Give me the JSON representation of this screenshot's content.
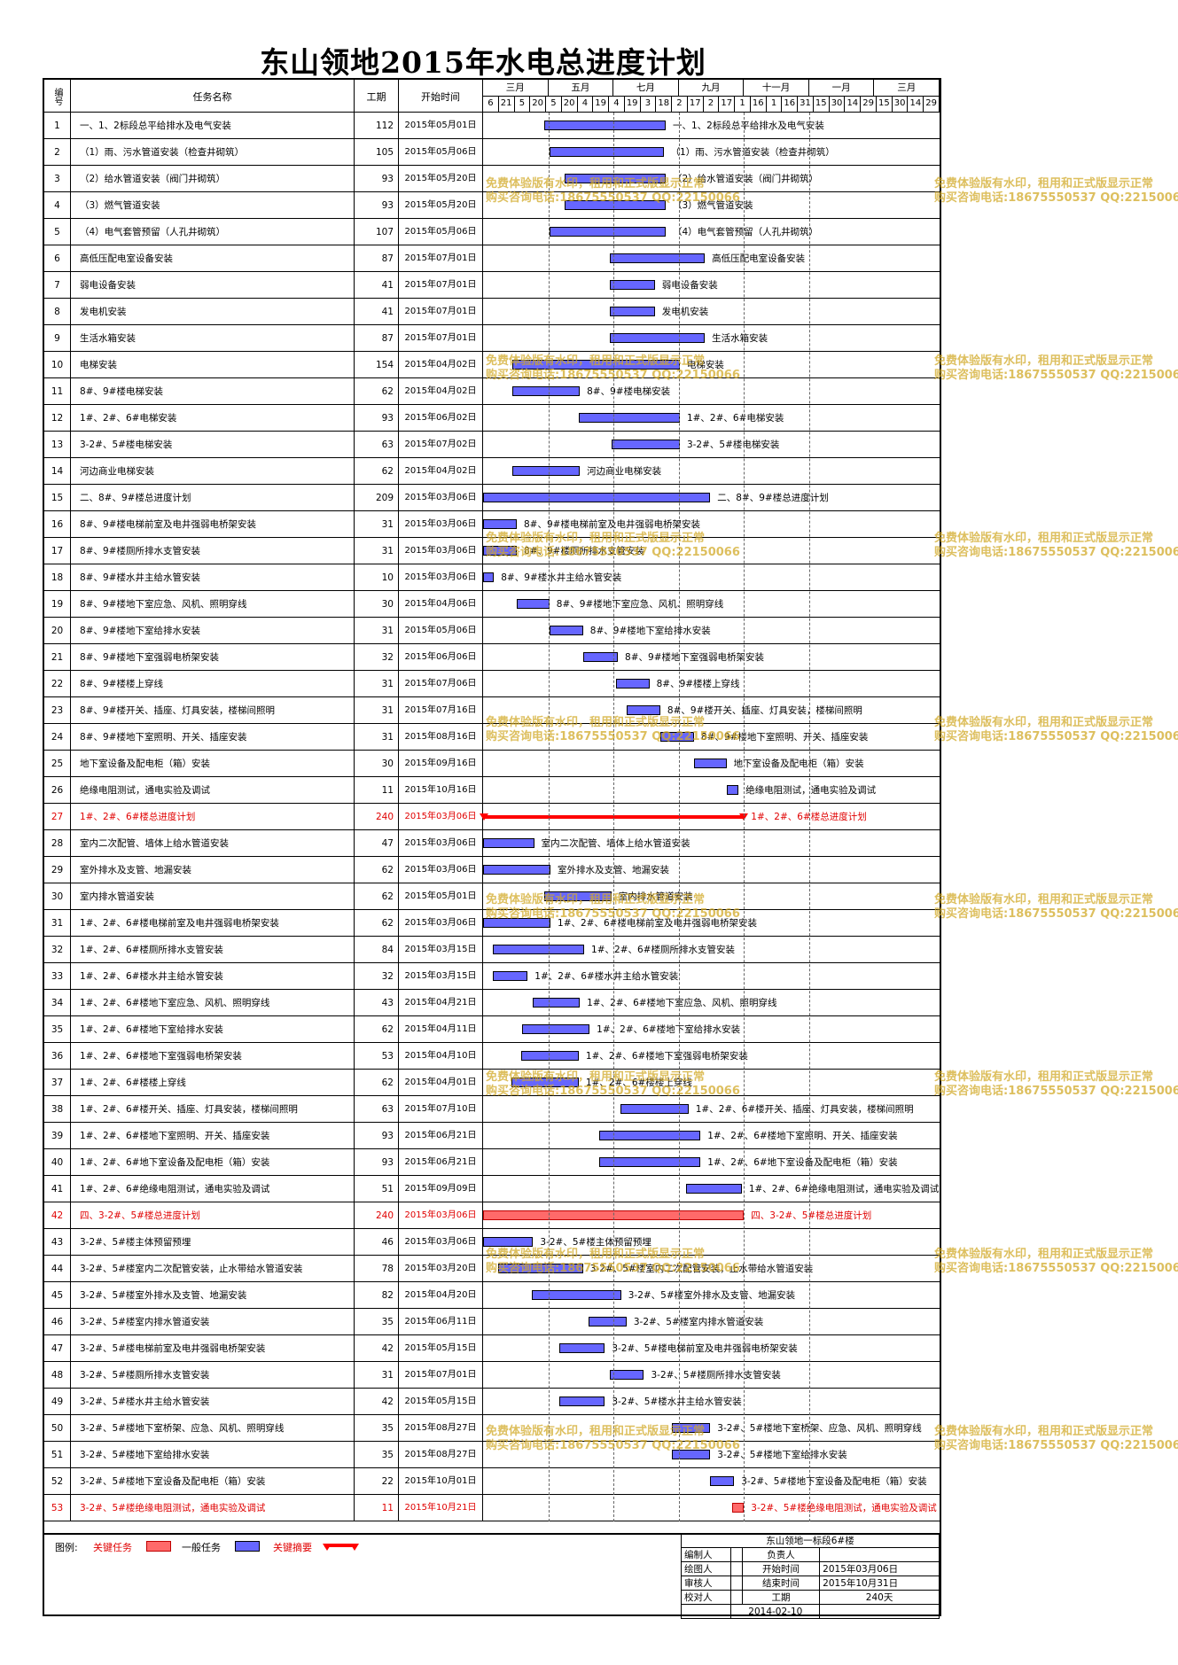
{
  "title": "东山领地2015年水电总进度计划",
  "headers": {
    "no": "编号",
    "name": "任务名称",
    "duration": "工期",
    "start": "开始时间"
  },
  "timeline": {
    "months": [
      "三月",
      "五月",
      "七月",
      "九月",
      "十一月",
      "一月",
      "三月"
    ],
    "days": [
      "6",
      "21",
      "5",
      "20",
      "5",
      "20",
      "4",
      "19",
      "4",
      "19",
      "3",
      "18",
      "2",
      "17",
      "2",
      "17",
      "1",
      "16",
      "1",
      "16",
      "31",
      "15",
      "30",
      "14",
      "29",
      "15",
      "30",
      "14",
      "29"
    ]
  },
  "tasks": [
    {
      "no": "1",
      "name": "一、1、2标段总平给排水及电气安装",
      "dur": "112",
      "start": "2015年05月01日",
      "type": "normal",
      "bar": [
        56,
        112
      ],
      "label": "一、1、2标段总平给排水及电气安装"
    },
    {
      "no": "2",
      "name": "（1）雨、污水管道安装（检查井砌筑）",
      "dur": "105",
      "start": "2015年05月06日",
      "type": "normal",
      "bar": [
        61,
        105
      ],
      "label": "（1）雨、污水管道安装（检查井砌筑）"
    },
    {
      "no": "3",
      "name": "（2）给水管道安装（阀门井砌筑）",
      "dur": "93",
      "start": "2015年05月20日",
      "type": "normal",
      "bar": [
        75,
        93
      ],
      "label": "（2）给水管道安装（阀门井砌筑）"
    },
    {
      "no": "4",
      "name": "（3）燃气管道安装",
      "dur": "93",
      "start": "2015年05月20日",
      "type": "normal",
      "bar": [
        75,
        93
      ],
      "label": "（3）燃气管道安装"
    },
    {
      "no": "5",
      "name": "（4）电气套管预留（人孔井砌筑）",
      "dur": "107",
      "start": "2015年05月06日",
      "type": "normal",
      "bar": [
        61,
        107
      ],
      "label": "（4）电气套管预留（人孔井砌筑）"
    },
    {
      "no": "6",
      "name": "高低压配电室设备安装",
      "dur": "87",
      "start": "2015年07月01日",
      "type": "normal",
      "bar": [
        117,
        87
      ],
      "label": "高低压配电室设备安装"
    },
    {
      "no": "7",
      "name": "弱电设备安装",
      "dur": "41",
      "start": "2015年07月01日",
      "type": "normal",
      "bar": [
        117,
        41
      ],
      "label": "弱电设备安装"
    },
    {
      "no": "8",
      "name": "发电机安装",
      "dur": "41",
      "start": "2015年07月01日",
      "type": "normal",
      "bar": [
        117,
        41
      ],
      "label": "发电机安装"
    },
    {
      "no": "9",
      "name": "生活水箱安装",
      "dur": "87",
      "start": "2015年07月01日",
      "type": "normal",
      "bar": [
        117,
        87
      ],
      "label": "生活水箱安装"
    },
    {
      "no": "10",
      "name": "电梯安装",
      "dur": "154",
      "start": "2015年04月02日",
      "type": "normal",
      "bar": [
        27,
        154
      ],
      "label": "电梯安装"
    },
    {
      "no": "11",
      "name": "8#、9#楼电梯安装",
      "dur": "62",
      "start": "2015年04月02日",
      "type": "normal",
      "bar": [
        27,
        62
      ],
      "label": "8#、9#楼电梯安装"
    },
    {
      "no": "12",
      "name": "1#、2#、6#电梯安装",
      "dur": "93",
      "start": "2015年06月02日",
      "type": "normal",
      "bar": [
        88,
        93
      ],
      "label": "1#、2#、6#电梯安装"
    },
    {
      "no": "13",
      "name": "3-2#、5#楼电梯安装",
      "dur": "63",
      "start": "2015年07月02日",
      "type": "normal",
      "bar": [
        118,
        63
      ],
      "label": "3-2#、5#楼电梯安装"
    },
    {
      "no": "14",
      "name": "河边商业电梯安装",
      "dur": "62",
      "start": "2015年04月02日",
      "type": "normal",
      "bar": [
        27,
        62
      ],
      "label": "河边商业电梯安装"
    },
    {
      "no": "15",
      "name": "二、8#、9#楼总进度计划",
      "dur": "209",
      "start": "2015年03月06日",
      "type": "normal",
      "bar": [
        0,
        209
      ],
      "label": "二、8#、9#楼总进度计划"
    },
    {
      "no": "16",
      "name": "8#、9#楼电梯前室及电井强弱电桥架安装",
      "dur": "31",
      "start": "2015年03月06日",
      "type": "normal",
      "bar": [
        0,
        31
      ],
      "label": "8#、9#楼电梯前室及电井强弱电桥架安装"
    },
    {
      "no": "17",
      "name": "8#、9#楼厕所排水支管安装",
      "dur": "31",
      "start": "2015年03月06日",
      "type": "normal",
      "bar": [
        0,
        31
      ],
      "label": "8#、9#楼厕所排水支管安装"
    },
    {
      "no": "18",
      "name": "8#、9#楼水井主给水管安装",
      "dur": "10",
      "start": "2015年03月06日",
      "type": "normal",
      "bar": [
        0,
        10
      ],
      "label": "8#、9#楼水井主给水管安装"
    },
    {
      "no": "19",
      "name": "8#、9#楼地下室应急、风机、照明穿线",
      "dur": "30",
      "start": "2015年04月06日",
      "type": "normal",
      "bar": [
        31,
        30
      ],
      "label": "8#、9#楼地下室应急、风机、照明穿线"
    },
    {
      "no": "20",
      "name": "8#、9#楼地下室给排水安装",
      "dur": "31",
      "start": "2015年05月06日",
      "type": "normal",
      "bar": [
        61,
        31
      ],
      "label": "8#、9#楼地下室给排水安装"
    },
    {
      "no": "21",
      "name": "8#、9#楼地下室强弱电桥架安装",
      "dur": "32",
      "start": "2015年06月06日",
      "type": "normal",
      "bar": [
        92,
        32
      ],
      "label": "8#、9#楼地下室强弱电桥架安装"
    },
    {
      "no": "22",
      "name": "8#、9#楼楼上穿线",
      "dur": "31",
      "start": "2015年07月06日",
      "type": "normal",
      "bar": [
        122,
        31
      ],
      "label": "8#、9#楼楼上穿线"
    },
    {
      "no": "23",
      "name": "8#、9#楼开关、插座、灯具安装，楼梯间照明",
      "dur": "31",
      "start": "2015年07月16日",
      "type": "normal",
      "bar": [
        132,
        31
      ],
      "label": "8#、9#楼开关、插座、灯具安装，楼梯间照明"
    },
    {
      "no": "24",
      "name": "8#、9#楼地下室照明、开关、插座安装",
      "dur": "31",
      "start": "2015年08月16日",
      "type": "normal",
      "bar": [
        163,
        31
      ],
      "label": "8#、9#楼地下室照明、开关、插座安装"
    },
    {
      "no": "25",
      "name": "地下室设备及配电柜（箱）安装",
      "dur": "30",
      "start": "2015年09月16日",
      "type": "normal",
      "bar": [
        194,
        30
      ],
      "label": "地下室设备及配电柜（箱）安装"
    },
    {
      "no": "26",
      "name": "绝缘电阻测试，通电实验及调试",
      "dur": "11",
      "start": "2015年10月16日",
      "type": "normal",
      "bar": [
        224,
        11
      ],
      "label": "绝缘电阻测试，通电实验及调试"
    },
    {
      "no": "27",
      "name": "1#、2#、6#楼总进度计划",
      "dur": "240",
      "start": "2015年03月06日",
      "type": "summary",
      "bar": [
        0,
        240
      ],
      "label": "1#、2#、6#楼总进度计划"
    },
    {
      "no": "28",
      "name": "室内二次配管、墙体上给水管道安装",
      "dur": "47",
      "start": "2015年03月06日",
      "type": "normal",
      "bar": [
        0,
        47
      ],
      "label": "室内二次配管、墙体上给水管道安装"
    },
    {
      "no": "29",
      "name": "室外排水及支管、地漏安装",
      "dur": "62",
      "start": "2015年03月06日",
      "type": "normal",
      "bar": [
        0,
        62
      ],
      "label": "室外排水及支管、地漏安装"
    },
    {
      "no": "30",
      "name": "室内排水管道安装",
      "dur": "62",
      "start": "2015年05月01日",
      "type": "normal",
      "bar": [
        56,
        62
      ],
      "label": "室内排水管道安装"
    },
    {
      "no": "31",
      "name": "1#、2#、6#楼电梯前室及电井强弱电桥架安装",
      "dur": "62",
      "start": "2015年03月06日",
      "type": "normal",
      "bar": [
        0,
        62
      ],
      "label": "1#、2#、6#楼电梯前室及电井强弱电桥架安装"
    },
    {
      "no": "32",
      "name": "1#、2#、6#楼厕所排水支管安装",
      "dur": "84",
      "start": "2015年03月15日",
      "type": "normal",
      "bar": [
        9,
        84
      ],
      "label": "1#、2#、6#楼厕所排水支管安装"
    },
    {
      "no": "33",
      "name": "1#、2#、6#楼水井主给水管安装",
      "dur": "32",
      "start": "2015年03月15日",
      "type": "normal",
      "bar": [
        9,
        32
      ],
      "label": "1#、2#、6#楼水井主给水管安装"
    },
    {
      "no": "34",
      "name": "1#、2#、6#楼地下室应急、风机、照明穿线",
      "dur": "43",
      "start": "2015年04月21日",
      "type": "normal",
      "bar": [
        46,
        43
      ],
      "label": "1#、2#、6#楼地下室应急、风机、照明穿线"
    },
    {
      "no": "35",
      "name": "1#、2#、6#楼地下室给排水安装",
      "dur": "62",
      "start": "2015年04月11日",
      "type": "normal",
      "bar": [
        36,
        62
      ],
      "label": "1#、2#、6#楼地下室给排水安装"
    },
    {
      "no": "36",
      "name": "1#、2#、6#楼地下室强弱电桥架安装",
      "dur": "53",
      "start": "2015年04月10日",
      "type": "normal",
      "bar": [
        35,
        53
      ],
      "label": "1#、2#、6#楼地下室强弱电桥架安装"
    },
    {
      "no": "37",
      "name": "1#、2#、6#楼楼上穿线",
      "dur": "62",
      "start": "2015年04月01日",
      "type": "normal",
      "bar": [
        26,
        62
      ],
      "label": "1#、2#、6#楼楼上穿线"
    },
    {
      "no": "38",
      "name": "1#、2#、6#楼开关、插座、灯具安装，楼梯间照明",
      "dur": "63",
      "start": "2015年07月10日",
      "type": "normal",
      "bar": [
        126,
        63
      ],
      "label": "1#、2#、6#楼开关、插座、灯具安装，楼梯间照明"
    },
    {
      "no": "39",
      "name": "1#、2#、6#楼地下室照明、开关、插座安装",
      "dur": "93",
      "start": "2015年06月21日",
      "type": "normal",
      "bar": [
        107,
        93
      ],
      "label": "1#、2#、6#楼地下室照明、开关、插座安装"
    },
    {
      "no": "40",
      "name": "1#、2#、6#地下室设备及配电柜（箱）安装",
      "dur": "93",
      "start": "2015年06月21日",
      "type": "normal",
      "bar": [
        107,
        93
      ],
      "label": "1#、2#、6#地下室设备及配电柜（箱）安装"
    },
    {
      "no": "41",
      "name": "1#、2#、6#绝缘电阻测试，通电实验及调试",
      "dur": "51",
      "start": "2015年09月09日",
      "type": "normal",
      "bar": [
        187,
        51
      ],
      "label": "1#、2#、6#绝缘电阻测试，通电实验及调试"
    },
    {
      "no": "42",
      "name": "四、3-2#、5#楼总进度计划",
      "dur": "240",
      "start": "2015年03月06日",
      "type": "critical",
      "bar": [
        0,
        240
      ],
      "label": "四、3-2#、5#楼总进度计划"
    },
    {
      "no": "43",
      "name": "3-2#、5#楼主体预留预埋",
      "dur": "46",
      "start": "2015年03月06日",
      "type": "normal",
      "bar": [
        0,
        46
      ],
      "label": "3-2#、5#楼主体预留预埋"
    },
    {
      "no": "44",
      "name": "3-2#、5#楼室内二次配管安装，止水带给水管道安装",
      "dur": "78",
      "start": "2015年03月20日",
      "type": "normal",
      "bar": [
        14,
        78
      ],
      "label": "3-2#、5#楼室内二次配管安装，止水带给水管道安装"
    },
    {
      "no": "45",
      "name": "3-2#、5#楼室外排水及支管、地漏安装",
      "dur": "82",
      "start": "2015年04月20日",
      "type": "normal",
      "bar": [
        45,
        82
      ],
      "label": "3-2#、5#楼室外排水及支管、地漏安装"
    },
    {
      "no": "46",
      "name": "3-2#、5#楼室内排水管道安装",
      "dur": "35",
      "start": "2015年06月11日",
      "type": "normal",
      "bar": [
        97,
        35
      ],
      "label": "3-2#、5#楼室内排水管道安装"
    },
    {
      "no": "47",
      "name": "3-2#、5#楼电梯前室及电井强弱电桥架安装",
      "dur": "42",
      "start": "2015年05月15日",
      "type": "normal",
      "bar": [
        70,
        42
      ],
      "label": "3-2#、5#楼电梯前室及电井强弱电桥架安装"
    },
    {
      "no": "48",
      "name": "3-2#、5#楼厕所排水支管安装",
      "dur": "31",
      "start": "2015年07月01日",
      "type": "normal",
      "bar": [
        117,
        31
      ],
      "label": "3-2#、5#楼厕所排水支管安装"
    },
    {
      "no": "49",
      "name": "3-2#、5#楼水井主给水管安装",
      "dur": "42",
      "start": "2015年05月15日",
      "type": "normal",
      "bar": [
        70,
        42
      ],
      "label": "3-2#、5#楼水井主给水管安装"
    },
    {
      "no": "50",
      "name": "3-2#、5#楼地下室桥架、应急、风机、照明穿线",
      "dur": "35",
      "start": "2015年08月27日",
      "type": "normal",
      "bar": [
        174,
        35
      ],
      "label": "3-2#、5#楼地下室桥架、应急、风机、照明穿线"
    },
    {
      "no": "51",
      "name": "3-2#、5#楼地下室给排水安装",
      "dur": "35",
      "start": "2015年08月27日",
      "type": "normal",
      "bar": [
        174,
        35
      ],
      "label": "3-2#、5#楼地下室给排水安装"
    },
    {
      "no": "52",
      "name": "3-2#、5#楼地下室设备及配电柜（箱）安装",
      "dur": "22",
      "start": "2015年10月01日",
      "type": "normal",
      "bar": [
        209,
        22
      ],
      "label": "3-2#、5#楼地下室设备及配电柜（箱）安装"
    },
    {
      "no": "53",
      "name": "3-2#、5#楼绝缘电阻测试，通电实验及调试",
      "dur": "11",
      "start": "2015年10月21日",
      "type": "critical",
      "bar": [
        229,
        11
      ],
      "label": "3-2#、5#楼绝缘电阻测试，通电实验及调试"
    }
  ],
  "legend": {
    "label": "图例:",
    "critical": "关键任务",
    "normal": "一般任务",
    "summary": "关键摘要"
  },
  "info": {
    "project": "东山领地一标段6#楼",
    "editor_label": "编制人",
    "owner_label": "负责人",
    "drawer_label": "绘图人",
    "start_label": "开始时间",
    "start_value": "2015年03月06日",
    "reviewer_label": "审核人",
    "end_label": "结束时间",
    "end_value": "2015年10月31日",
    "checker_label": "校对人",
    "dur_label": "工期",
    "dur_value": "240天",
    "date": "2014-02-10"
  },
  "watermark": {
    "line1": "免费体验版有水印，租用和正式版显示正常",
    "line2": "购买咨询电话:18675550537 QQ:22150066"
  },
  "colors": {
    "normal_bar": "#6666ff",
    "critical_bar": "#ff6a6a",
    "summary_line": "#ff0000",
    "critical_text": "#e00000"
  }
}
